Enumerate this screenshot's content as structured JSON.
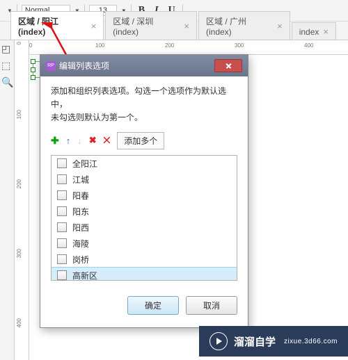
{
  "toolbar": {
    "style_select": "Normal",
    "font_size": "13",
    "bold": "B",
    "italic": "I",
    "underline": "U"
  },
  "tabs": [
    {
      "label": "区域 / 阳江 (index)"
    },
    {
      "label": "区域 / 深圳 (index)"
    },
    {
      "label": "区域 / 广州 (index)"
    },
    {
      "label": "index"
    }
  ],
  "ruler_h": {
    "t0": "0",
    "t100": "100",
    "t200": "200",
    "t300": "300",
    "t400": "400"
  },
  "ruler_v": {
    "t0": "0",
    "t100": "100",
    "t200": "200",
    "t300": "300",
    "t400": "400"
  },
  "dialog": {
    "title": "编辑列表选项",
    "msg1": "添加和组织列表选项。勾选一个选项作为默认选中，",
    "msg2": "未勾选则默认为第一个。",
    "ops": {
      "add": "✚",
      "up": "↑",
      "down": "↓",
      "del": "✖",
      "del_all": "⨉",
      "multi": "添加多个"
    },
    "items": [
      {
        "label": "全阳江"
      },
      {
        "label": "江城"
      },
      {
        "label": "阳春"
      },
      {
        "label": "阳东"
      },
      {
        "label": "阳西"
      },
      {
        "label": "海陵"
      },
      {
        "label": "岗桥"
      },
      {
        "label": "高新区"
      }
    ],
    "btn_ok": "确定",
    "btn_cancel": "取消"
  },
  "watermark": {
    "name": "溜溜自学",
    "url": "zixue.3d66.com"
  }
}
